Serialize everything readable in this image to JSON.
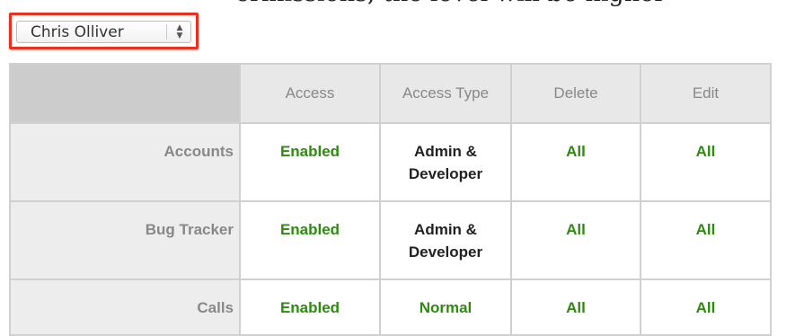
{
  "page_header_fragment": "ermissions, the level will be higher",
  "user_select": {
    "value": "Chris Olliver",
    "arrows": "▴▾"
  },
  "colors": {
    "enabled": "#2e8b10",
    "highlight_border": "#e8321f"
  },
  "table": {
    "headers": [
      "",
      "Access",
      "Access Type",
      "Delete",
      "Edit"
    ],
    "rows": [
      {
        "module": "Accounts",
        "access": "Enabled",
        "access_type": "Admin & Developer",
        "delete": "All",
        "edit": "All"
      },
      {
        "module": "Bug Tracker",
        "access": "Enabled",
        "access_type": "Admin & Developer",
        "delete": "All",
        "edit": "All"
      },
      {
        "module": "Calls",
        "access": "Enabled",
        "access_type": "Normal",
        "delete": "All",
        "edit": "All"
      }
    ]
  }
}
